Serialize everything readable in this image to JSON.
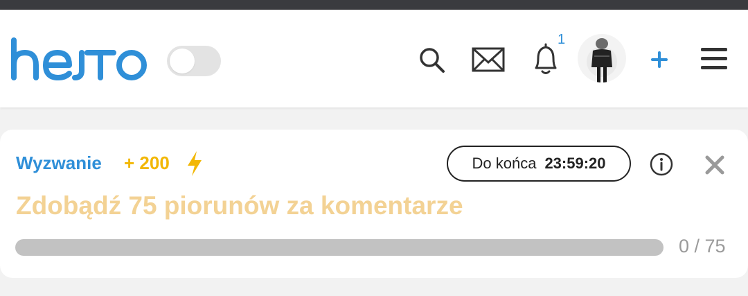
{
  "header": {
    "logo_text": "hejto",
    "notifications_count": "1",
    "icons": {
      "search": "search-icon",
      "mail": "mail-icon",
      "bell": "bell-icon",
      "plus": "plus-icon",
      "menu": "hamburger-menu-icon"
    },
    "dark_mode_enabled": false
  },
  "challenge": {
    "label": "Wyzwanie",
    "reward": "+ 200",
    "reward_icon": "lightning-bolt-icon",
    "timer_label": "Do końca",
    "timer_value": "23:59:20",
    "title": "Zdobądź 75 piorunów za komentarze",
    "progress_text": "0 / 75",
    "progress_fraction": 0
  },
  "colors": {
    "brand_blue": "#2f8fd8",
    "reward_yellow": "#f2b705",
    "title_yellow": "#f3d294",
    "track_gray": "#c2c2c2",
    "topbar_dark": "#3a3b3f"
  }
}
